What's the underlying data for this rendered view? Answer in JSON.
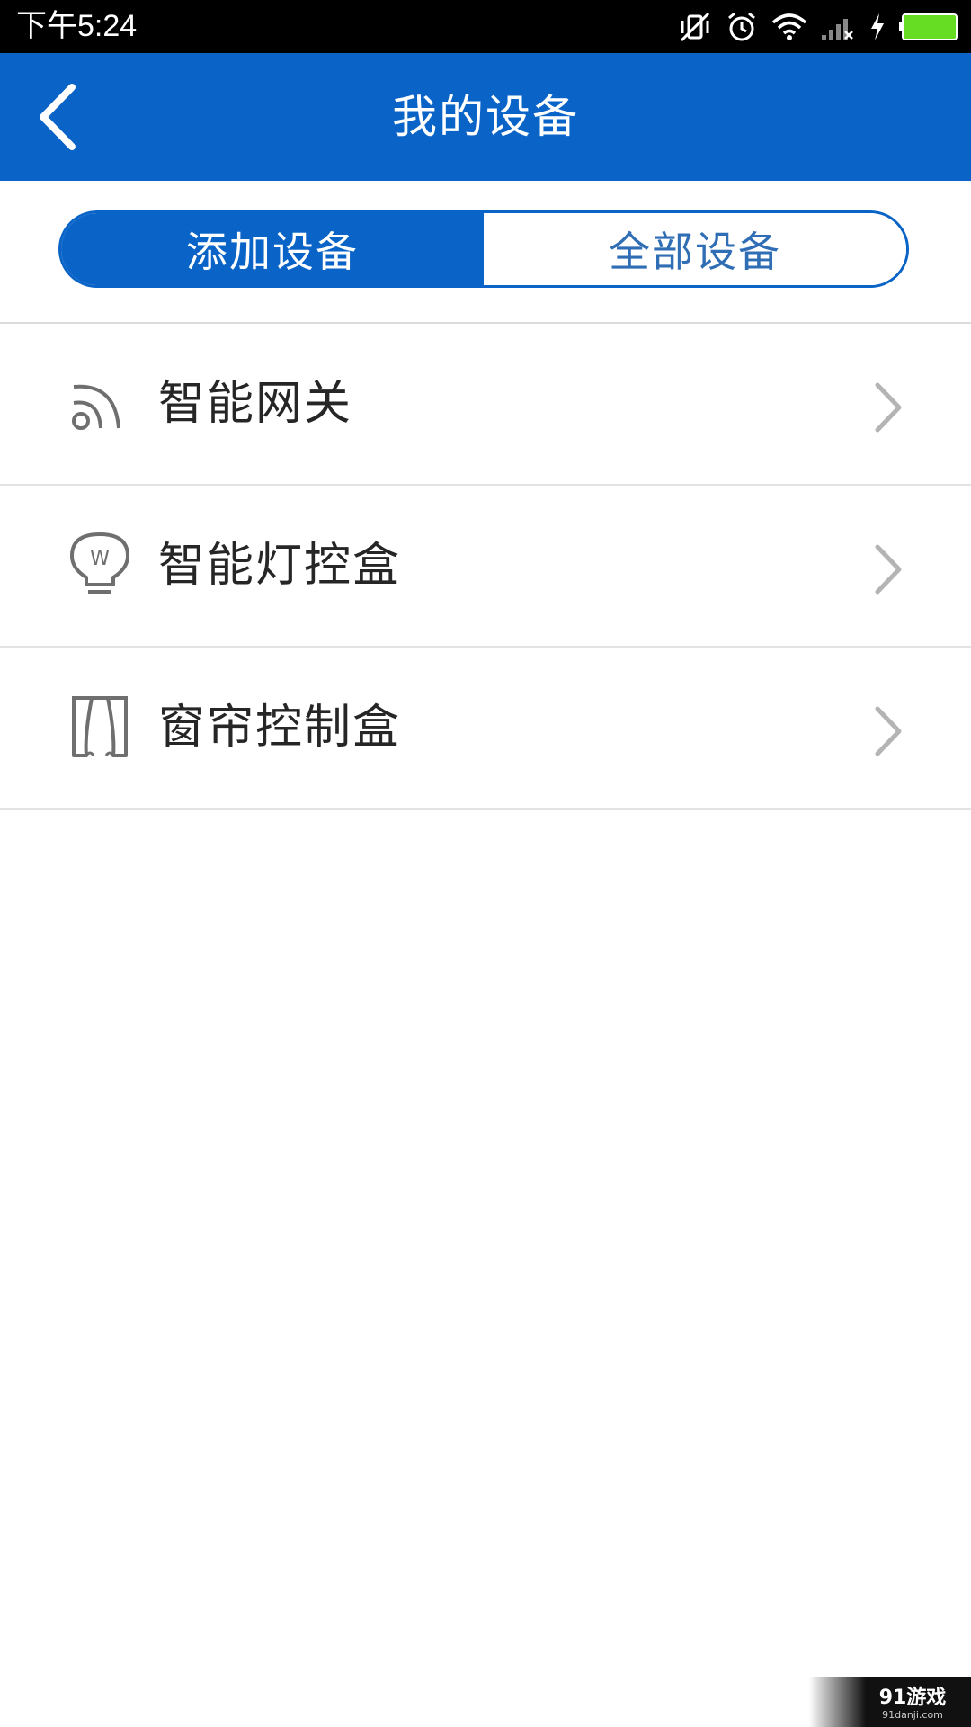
{
  "status_bar": {
    "time": "下午5:24",
    "icons": [
      "vibrate-off-icon",
      "alarm-icon",
      "wifi-icon",
      "signal-icon",
      "charging-icon",
      "battery-icon"
    ],
    "battery_color": "#66dd22"
  },
  "header": {
    "title": "我的设备",
    "background": "#0a64c8",
    "back_icon": "back-arrow-icon"
  },
  "segments": {
    "items": [
      {
        "label": "添加设备",
        "active": true
      },
      {
        "label": "全部设备",
        "active": false
      }
    ],
    "accent": "#0a64c8"
  },
  "device_list": {
    "items": [
      {
        "label": "智能网关",
        "icon": "gateway-signal-icon"
      },
      {
        "label": "智能灯控盒",
        "icon": "lightbulb-icon"
      },
      {
        "label": "窗帘控制盒",
        "icon": "curtain-icon"
      }
    ],
    "chevron_icon": "chevron-right-icon"
  },
  "watermark": {
    "brand": "91游戏",
    "site": "91danji.com"
  }
}
